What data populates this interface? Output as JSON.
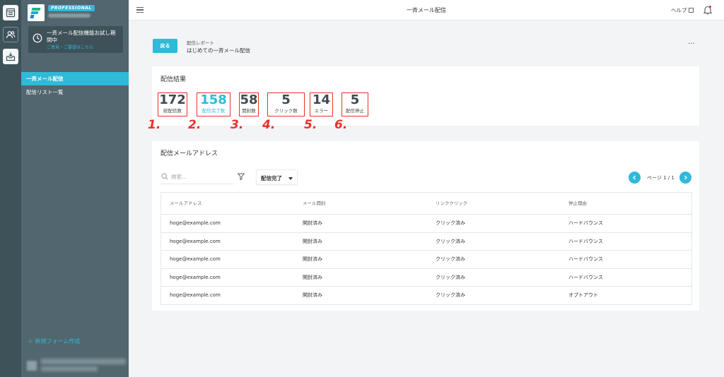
{
  "brand": {
    "plan_badge": "PROFESSIONAL"
  },
  "trial": {
    "message": "一斉メール配信機能お試し期間中",
    "link": "ご意見・ご要望はこちら"
  },
  "sidebar": {
    "items": [
      {
        "label": "一斉メール配信",
        "active": true
      },
      {
        "label": "配信リスト一覧",
        "active": false
      }
    ],
    "new_form": "＋ 新規フォーム作成"
  },
  "header": {
    "title": "一斉メール配信",
    "help": "ヘルプ"
  },
  "toolbar": {
    "back_label": "戻る",
    "breadcrumb_parent": "配信レポート",
    "breadcrumb_current": "はじめての一斉メール配信",
    "more": "···"
  },
  "results": {
    "title": "配信結果",
    "stats": [
      {
        "value": "172",
        "label": "総配信数",
        "marker": "1."
      },
      {
        "value": "158",
        "label": "配信完了数",
        "marker": "2."
      },
      {
        "value": "58",
        "label": "開封数",
        "marker": "3."
      },
      {
        "value": "5",
        "label": "クリック数",
        "marker": "4."
      },
      {
        "value": "14",
        "label": "エラー",
        "marker": "5."
      },
      {
        "value": "5",
        "label": "配信停止",
        "marker": "6."
      }
    ]
  },
  "addresses": {
    "title": "配信メールアドレス",
    "search_placeholder": "検索...",
    "filter_value": "配信完了",
    "pagination": "ページ 1 / 1",
    "columns": [
      "メールアドレス",
      "メール開封",
      "リンククリック",
      "停止理由"
    ],
    "rows": [
      [
        "hoge@example.com",
        "開封済み",
        "クリック済み",
        "ハードバウンス"
      ],
      [
        "hoge@example.com",
        "開封済み",
        "クリック済み",
        "ハードバウンス"
      ],
      [
        "hoge@example.com",
        "開封済み",
        "クリック済み",
        "ハードバウンス"
      ],
      [
        "hoge@example.com",
        "開封済み",
        "クリック済み",
        "ハードバウンス"
      ],
      [
        "hoge@example.com",
        "開封済み",
        "クリック済み",
        "オプトアウト"
      ]
    ]
  },
  "colors": {
    "accent": "#2ebad8",
    "highlight_box": "#e8322c",
    "sidebar": "#51666e",
    "rail": "#3d5259"
  }
}
